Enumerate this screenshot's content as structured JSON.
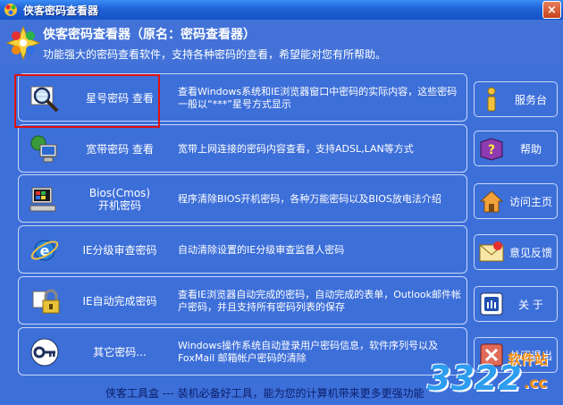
{
  "window": {
    "title": "侠客密码查看器",
    "close_glyph": "×"
  },
  "header": {
    "title": "侠客密码查看器（原名：密码查看器）",
    "subtitle": "功能强大的密码查看软件，支持各种密码的查看，希望能对您有所帮助。"
  },
  "features": [
    {
      "label": "星号密码 查看",
      "desc": "查看Windows系统和IE浏览器窗口中密码的实际内容，这些密码一般以“***”星号方式显示",
      "icon": "magnifier-icon"
    },
    {
      "label": "宽带密码 查看",
      "desc": "宽带上网连接的密码内容查看，支持ADSL,LAN等方式",
      "icon": "network-computer-icon"
    },
    {
      "label": "Bios(Cmos)\n开机密码",
      "desc": "程序清除BIOS开机密码，各种万能密码以及BIOS放电法介绍",
      "icon": "bios-computer-icon"
    },
    {
      "label": "IE分级审查密码",
      "desc": "自动清除设置的IE分级审查监督人密码",
      "icon": "ie-icon"
    },
    {
      "label": "IE自动完成密码",
      "desc": "查看IE浏览器自动完成的密码，自动完成的表单，Outlook邮件帐户密码，并且支持所有密码列表的保存",
      "icon": "lock-icon"
    },
    {
      "label": "其它密码...",
      "desc": "Windows操作系统自动登录用户密码信息，软件序列号以及FoxMail 邮箱帐户密码的清除",
      "icon": "key-icon"
    }
  ],
  "sidebar": [
    {
      "label": "服务台",
      "icon": "info-icon"
    },
    {
      "label": "帮助",
      "icon": "help-book-icon"
    },
    {
      "label": "访问主页",
      "icon": "home-icon"
    },
    {
      "label": "意见反馈",
      "icon": "envelope-icon"
    },
    {
      "label": "关  于",
      "icon": "about-icon"
    },
    {
      "label": "关闭退出",
      "icon": "close-exit-icon"
    }
  ],
  "footer": {
    "text": "侠客工具盒 --- 装机必备好工具，能为您的计算机带来更多更强功能"
  },
  "watermark": {
    "number": "3322",
    "site": "软件站",
    "domain": ".cc"
  },
  "colors": {
    "background": "#3d6fd9",
    "highlight": "#e01010",
    "footer_text": "#0b1f6a",
    "watermark_blue": "#2d9df0",
    "watermark_orange": "#f08a10"
  }
}
